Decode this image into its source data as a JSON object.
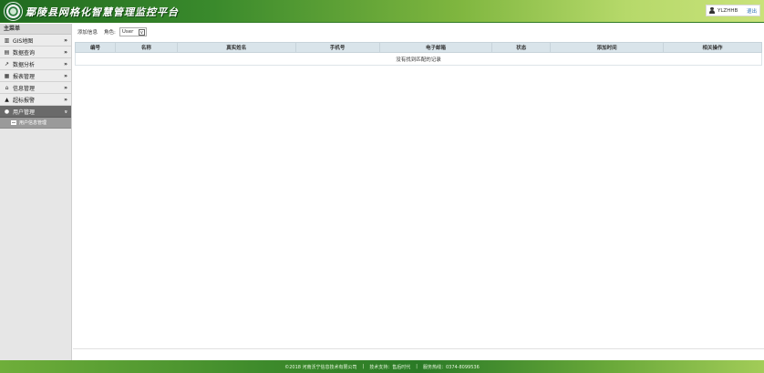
{
  "header": {
    "title": "鄢陵县网格化智慧管理监控平台",
    "user_name": "YLZHHB",
    "logout": "退出"
  },
  "sidebar": {
    "heading": "主菜单",
    "items": [
      {
        "label": "GIS地图",
        "icon": "map-icon",
        "chevron": "»"
      },
      {
        "label": "数据查询",
        "icon": "database-icon",
        "chevron": "»"
      },
      {
        "label": "数据分析",
        "icon": "chart-line-icon",
        "chevron": "»"
      },
      {
        "label": "报表管理",
        "icon": "report-icon",
        "chevron": "»"
      },
      {
        "label": "信息管理",
        "icon": "bank-icon",
        "chevron": "»"
      },
      {
        "label": "超标报警",
        "icon": "warning-icon",
        "chevron": "»"
      },
      {
        "label": "用户管理",
        "icon": "user-icon",
        "chevron": "»"
      }
    ],
    "sub_items": [
      {
        "label": "用户信息管理",
        "icon": "list-icon"
      }
    ]
  },
  "toolbar": {
    "add_label": "添加信息",
    "role_label": "角色:",
    "role_value": "User"
  },
  "table": {
    "columns": [
      "编号",
      "名称",
      "真实姓名",
      "手机号",
      "电子邮箱",
      "状态",
      "添加时间",
      "相关操作"
    ],
    "empty_text": "没有找到匹配的记录"
  },
  "footer": {
    "copyright": "©2018 河南沃宁信息技术有限公司",
    "support": "技术支持：售后时代",
    "hotline": "服务热线：0374-8099536"
  },
  "colors": {
    "header_green": "#3a8a2c",
    "active_nav": "#6a6a6a",
    "table_header": "#d9e4ea"
  }
}
